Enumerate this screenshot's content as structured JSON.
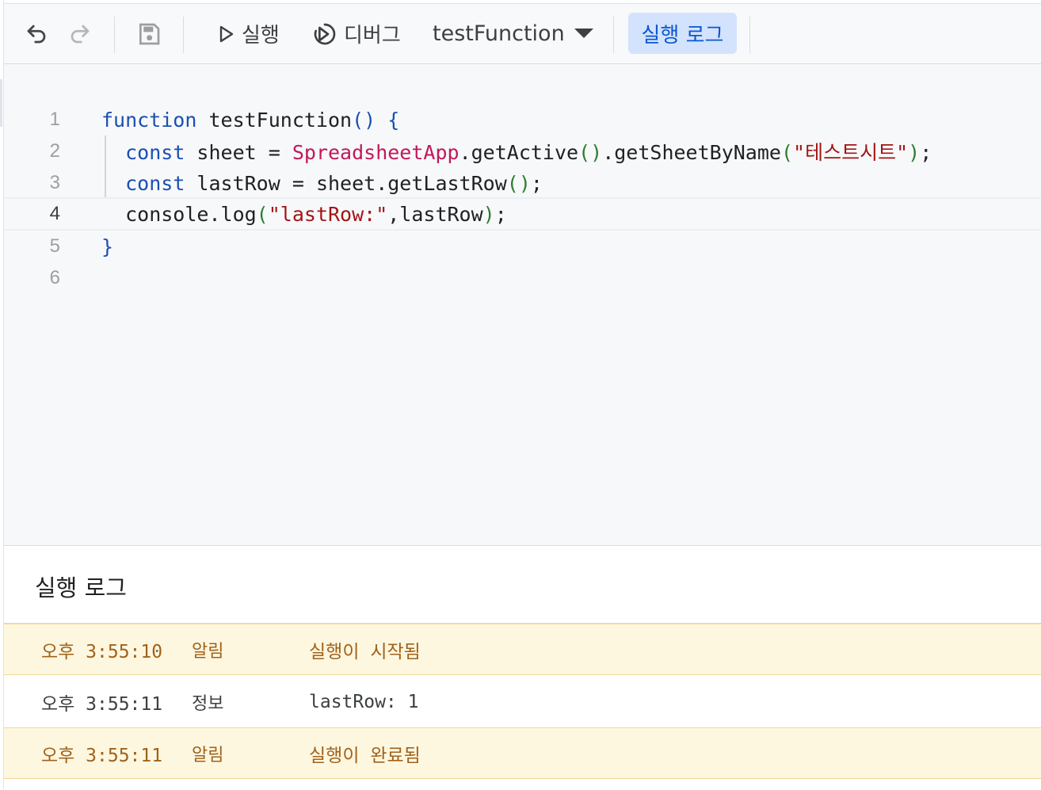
{
  "toolbar": {
    "undo_icon": "undo-icon",
    "redo_icon": "redo-icon",
    "save_icon": "save-icon",
    "run_label": "실행",
    "debug_label": "디버그",
    "function_select": "testFunction",
    "log_button": "실행 로그"
  },
  "editor": {
    "current_line": 4,
    "line_numbers": [
      "1",
      "2",
      "3",
      "4",
      "5",
      "6"
    ]
  },
  "log": {
    "title": "실행 로그",
    "entries": [
      {
        "time": "오후 3:55:10",
        "level": "알림",
        "message": "실행이 시작됨",
        "type": "notice"
      },
      {
        "time": "오후 3:55:11",
        "level": "정보",
        "message": "lastRow: 1",
        "type": "info"
      },
      {
        "time": "오후 3:55:11",
        "level": "알림",
        "message": "실행이 완료됨",
        "type": "notice"
      }
    ]
  },
  "colors": {
    "accent": "#0b57d0",
    "log_button_bg": "#d3e3fd",
    "notice_bg": "#fef7e0",
    "notice_text": "#a0621a"
  }
}
